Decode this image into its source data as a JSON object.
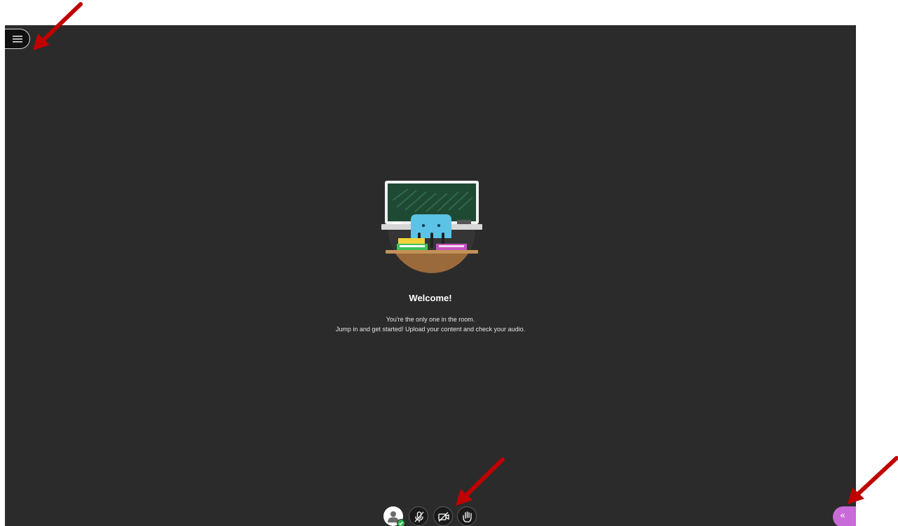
{
  "colors": {
    "room_background": "#2b2b2b",
    "panel_toggle": "#c86ad8",
    "annotation_arrow": "#c00000",
    "status_ok": "#2bb34a"
  },
  "welcome": {
    "title": "Welcome!",
    "line1": "You're the only one in the room.",
    "line2": "Jump in and get started! Upload your content and check your audio."
  },
  "icons": {
    "menu": "hamburger-menu-icon",
    "avatar": "user-avatar-icon",
    "status": "check-icon",
    "microphone": "microphone-muted-icon",
    "camera": "camera-off-icon",
    "hand": "raise-hand-icon",
    "panel_toggle": "double-chevron-left-icon"
  },
  "panel_toggle": {
    "glyph": "«"
  }
}
